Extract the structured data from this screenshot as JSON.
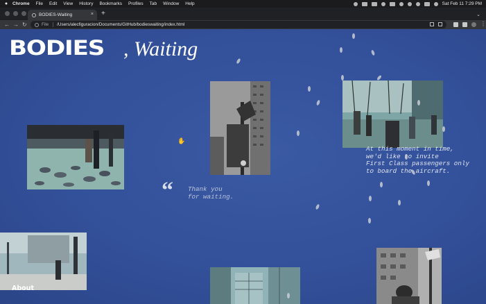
{
  "menubar": {
    "apple": "",
    "items": [
      "Chrome",
      "File",
      "Edit",
      "View",
      "History",
      "Bookmarks",
      "Profiles",
      "Tab",
      "Window",
      "Help"
    ],
    "clock": "Sat Feb 11  7:29 PM"
  },
  "browser": {
    "tab_title": "BODIES-Waiting",
    "tab_close": "×",
    "new_tab": "+",
    "tab_menu": "⌄",
    "back": "←",
    "forward": "→",
    "reload": "↻",
    "scheme_label": "File",
    "url": "/Users/alecfiguracion/Documents/GitHub/bodieswaiting/index.html"
  },
  "site": {
    "logo_bold": "BODIES",
    "logo_italic": ", Waiting",
    "quote_mark": "“",
    "thanks_text": "Thank you\nfor waiting.",
    "announcement": "At this moment in time,\nwe'd like to invite\nFirst Class passengers only\nto board the aircraft.",
    "about_link": "About",
    "cursor_icon": "hand-pointer-icon"
  },
  "colors": {
    "page_background": "#33509a",
    "menubar": "#1b1b1d",
    "tabstrip": "#202124",
    "toolbar": "#35363a"
  }
}
